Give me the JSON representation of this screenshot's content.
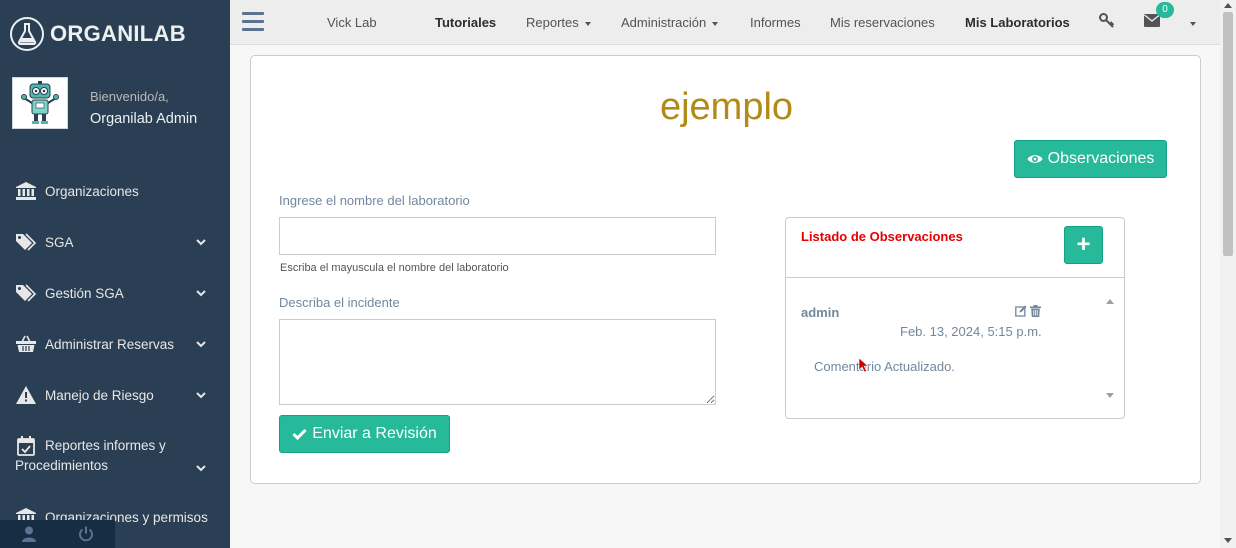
{
  "sidebar": {
    "brand": "ORGANILAB",
    "welcome": "Bienvenido/a,",
    "username": "Organilab Admin",
    "items": [
      {
        "label": "Organizaciones",
        "icon": "bank-icon"
      },
      {
        "label": "SGA",
        "icon": "tags-icon"
      },
      {
        "label": "Gestión SGA",
        "icon": "tags-icon"
      },
      {
        "label": "Administrar Reservas",
        "icon": "basket-icon"
      },
      {
        "label": "Manejo de Riesgo",
        "icon": "warning-icon"
      },
      {
        "label": "Reportes informes y",
        "label2": "Procedimientos",
        "icon": "calendar-check-icon"
      },
      {
        "label": "Organizaciones y permisos",
        "icon": "bank-icon"
      }
    ]
  },
  "topnav": {
    "lab": "Vick Lab",
    "tutorials": "Tutoriales",
    "reports": "Reportes",
    "admin": "Administración",
    "informes": "Informes",
    "reservations": "Mis reservaciones",
    "labs": "Mis Laboratorios",
    "badge_count": "0"
  },
  "main": {
    "title": "ejemplo",
    "observations_button": "Observaciones",
    "lab_name_label": "Ingrese el nombre del laboratorio",
    "lab_name_value": "",
    "lab_name_help": "Escriba el mayuscula el nombre del laboratorio",
    "incident_label": "Describa el incidente",
    "incident_value": "",
    "submit_button": "Enviar a Revisión"
  },
  "observations": {
    "title": "Listado de Observaciones",
    "add_button": "+",
    "items": [
      {
        "user": "admin",
        "date": "Feb. 13, 2024, 5:15 p.m.",
        "comment": "Comentario Actualizado."
      }
    ]
  },
  "colors": {
    "sidebar": "#2a3f54",
    "accent": "#26b99a",
    "title": "#b28a18",
    "obs_title": "#e60000"
  }
}
